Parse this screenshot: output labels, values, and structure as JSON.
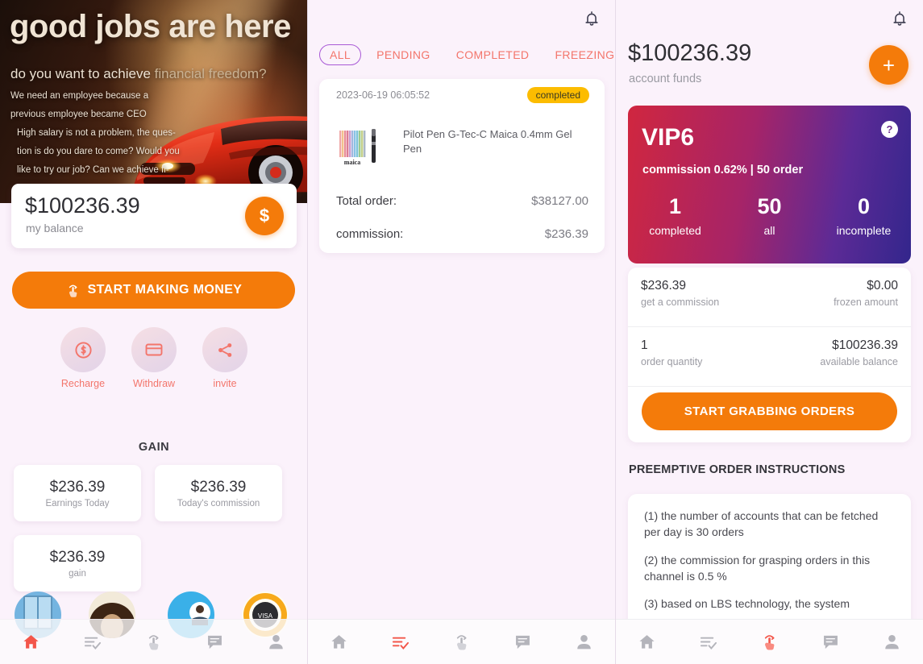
{
  "panel1": {
    "hero": {
      "headline": "good jobs are here",
      "subhead_a": "do you want to achieve ",
      "subhead_b": "financial freedom?",
      "body_lines": [
        "We need an employee because a previous employee became CEO",
        "High salary is not a problem, the ques-",
        "tion is do you dare to come? Would you",
        "like to try our job? Can we achieve fi-"
      ]
    },
    "balance": {
      "amount": "$100236.39",
      "label": "my balance",
      "fab_icon": "dollar-icon",
      "fab_symbol": "$"
    },
    "cta_label": "START MAKING MONEY",
    "quick_actions": [
      {
        "label": "Recharge",
        "icon": "dollar-coin-icon"
      },
      {
        "label": "Withdraw",
        "icon": "credit-card-icon"
      },
      {
        "label": "invite",
        "icon": "share-icon"
      }
    ],
    "gain_title": "GAIN",
    "gain_cards": [
      {
        "value": "$236.39",
        "label": "Earnings Today"
      },
      {
        "value": "$236.39",
        "label": "Today's commission"
      },
      {
        "value": "$236.39",
        "label": "gain"
      }
    ]
  },
  "panel2": {
    "bell_icon": "notification-bell-icon",
    "tabs": [
      {
        "label": "ALL",
        "active": true
      },
      {
        "label": "PENDING",
        "active": false
      },
      {
        "label": "COMPLETED",
        "active": false
      },
      {
        "label": "FREEZING",
        "active": false
      }
    ],
    "order": {
      "date": "2023-06-19 06:05:52",
      "status": "completed",
      "product_name": "Pilot Pen G-Tec-C Maica 0.4mm Gel Pen",
      "thumb_caption": "maica",
      "total_label": "Total order:",
      "total_value": "$38127.00",
      "commission_label": "commission:",
      "commission_value": "$236.39"
    }
  },
  "panel3": {
    "bell_icon": "notification-bell-icon",
    "account": {
      "amount": "$100236.39",
      "label": "account funds",
      "add_icon": "plus-icon",
      "add_symbol": "+"
    },
    "vip": {
      "title": "VIP6",
      "help_symbol": "?",
      "subtitle": "commission 0.62% | 50 order",
      "stats": [
        {
          "number": "1",
          "label": "completed"
        },
        {
          "number": "50",
          "label": "all"
        },
        {
          "number": "0",
          "label": "incomplete"
        }
      ]
    },
    "stats": [
      {
        "left_value": "$236.39",
        "left_label": "get a commission",
        "right_value": "$0.00",
        "right_label": "frozen amount"
      },
      {
        "left_value": "1",
        "left_label": "order quantity",
        "right_value": "$100236.39",
        "right_label": "available balance"
      }
    ],
    "grab_label": "START GRABBING ORDERS",
    "instructions_title": "PREEMPTIVE ORDER INSTRUCTIONS",
    "instructions": [
      "(1) the number of accounts that can be fetched per day is 30 orders",
      "(2) the commission for grasping orders in this channel is 0.5 %",
      "(3) based on LBS technology, the system"
    ]
  },
  "nav": {
    "items": [
      {
        "name": "home",
        "icon": "home-icon"
      },
      {
        "name": "orders",
        "icon": "order-list-check-icon"
      },
      {
        "name": "grab",
        "icon": "tap-hand-icon"
      },
      {
        "name": "messages",
        "icon": "chat-bubble-icon"
      },
      {
        "name": "profile",
        "icon": "person-icon"
      }
    ],
    "active_panel1": 0,
    "active_panel2": 1,
    "active_panel3": 2
  },
  "colors": {
    "accent_orange": "#f47b0a",
    "accent_red": "#f3756b",
    "badge_amber": "#fcbc00",
    "tab_outline_purple": "#a95ad6",
    "page_bg": "#fbf2fb",
    "vip_gradient_start": "#d0263f",
    "vip_gradient_end": "#33268c"
  }
}
